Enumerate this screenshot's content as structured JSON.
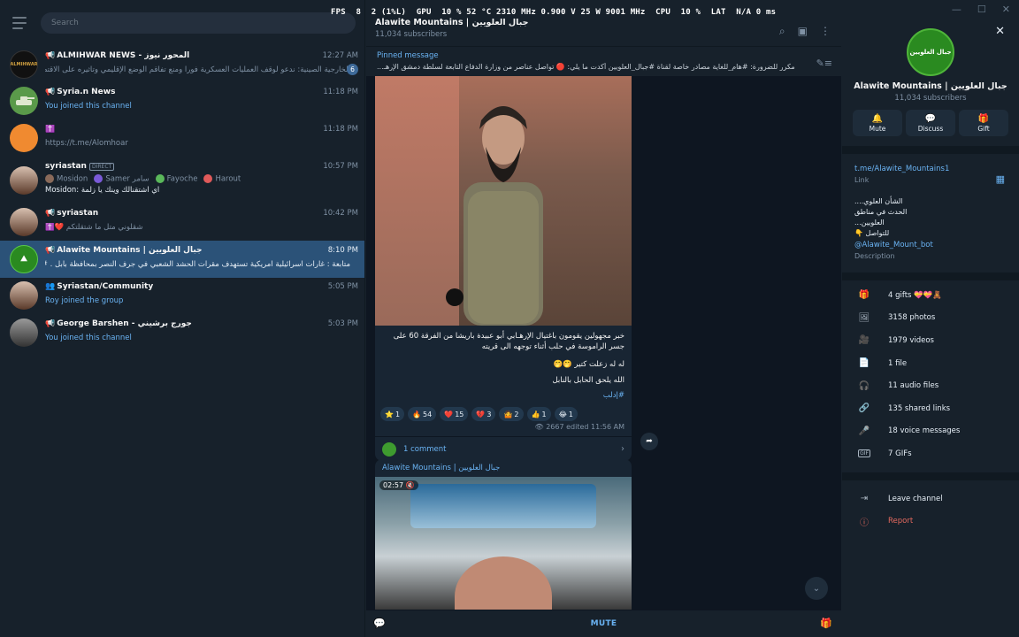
{
  "perf": {
    "fps_label": "FPS",
    "fps_value": "8",
    "fps_extra": "2 (1%L)",
    "gpu_label": "GPU",
    "gpu_value": "10 % 52 °C 2310 MHz 0.900 V 25 W 9001 MHz",
    "cpu_label": "CPU",
    "cpu_value": "10 %",
    "lat_label": "LAT",
    "lat_value": "N/A 0 ms"
  },
  "search": {
    "placeholder": "Search"
  },
  "chats": [
    {
      "title": "ALMIHWAR NEWS - المحور نيوز",
      "message": "الخارجية الصينية: ندعو لوقف العمليات العسكرية فورا ومنع تفاقم الوضع الإقليمي وتأثيره على الاقتصاد...",
      "time": "12:27 AM",
      "unread": "6",
      "avatar_text": "ALMIHWAR",
      "avatar_color": "#111111"
    },
    {
      "title": "Syria.n News",
      "message": "You joined this channel",
      "time": "11:18 PM",
      "avatar_color": "#5a9a4a"
    },
    {
      "title": "✝️",
      "message": "https://t.me/Alomhoar",
      "time": "11:18 PM",
      "avatar_color": "#f08a30"
    },
    {
      "title": "syriastan",
      "direct": "DIRECT",
      "participants": [
        "Mosidon",
        "Samer سامر",
        "Fayoche",
        "Harout"
      ],
      "message": "Mosidon: اي اشتقنالك وينك يا زلمة",
      "time": "10:57 PM",
      "avatar_color": "#8a6a5a"
    },
    {
      "title": "syriastan",
      "message": "شقلوني متل ما شتقلتكم",
      "time": "10:42 PM",
      "avatar_color": "#8a6a5a"
    },
    {
      "title": "Alawite Mountains | جبال العلويين",
      "message": "متابعة : غارات اسرائيلية امريكية تستهدف مقرات الحشد الشعبي في جرف النصر بمحافظة بابل . #رعد",
      "time": "8:10 PM",
      "avatar_color": "#2a8a20"
    },
    {
      "title": "Syriastan/Community",
      "message": "Roy joined the group",
      "time": "5:05 PM",
      "avatar_color": "#8a6a5a"
    },
    {
      "title": "George Barshen - جورج برشيني",
      "message": "You joined this channel",
      "time": "5:03 PM",
      "avatar_color": "#555555"
    }
  ],
  "channel": {
    "title": "Alawite Mountains | جبال العلويين",
    "subscribers": "11,034 subscribers"
  },
  "pinned": {
    "label": "Pinned message",
    "text": "مكرر للضرورة: #هام_للغاية   مصادر خاصة لقناة #جبال_العلويين أكدت ما يلي: 🔴 تواصل عناصر من وزارة الدفاع التابعة لسلطة دمشق الإرهـ..."
  },
  "post": {
    "text1": "خبر مجهولين يقومون باغتيال الإرهـابي أبو عبيدة باريشا من الفرقة 60 على جسر الراموسة في حلب أثناء توجهه الى قريته",
    "text2": "له له زعلت كتير 🤭🤭",
    "text3": "الله يلحق الحابل بالنابل",
    "tag": "#إدلب",
    "reactions": [
      {
        "emoji": "⭐",
        "count": "1"
      },
      {
        "emoji": "🔥",
        "count": "54"
      },
      {
        "emoji": "❤️",
        "count": "15"
      },
      {
        "emoji": "💔",
        "count": "3"
      },
      {
        "emoji": "🤷",
        "count": "2"
      },
      {
        "emoji": "👍",
        "count": "1"
      },
      {
        "emoji": "😂",
        "count": "1"
      }
    ],
    "views": "👁 2667",
    "edited": "edited 11:56 AM",
    "comments": "1 comment"
  },
  "post2": {
    "author": "Alawite Mountains | جبال العلويين",
    "video_time": "02:57 🔇"
  },
  "footer": {
    "mute": "MUTE"
  },
  "profile": {
    "avatar_text": "جبال العلويين",
    "name": "Alawite Mountains | جبال العلويين",
    "subscribers": "11,034 subscribers",
    "actions": [
      {
        "icon": "🔔",
        "label": "Mute"
      },
      {
        "icon": "💬",
        "label": "Discuss"
      },
      {
        "icon": "🎁",
        "label": "Gift"
      }
    ],
    "link": "t.me/Alawite_Mountains1",
    "link_label": "Link",
    "desc_line1": "الشأن العلوي....",
    "desc_line2": "الحدث في مناطق العلويين...",
    "desc_line3": "للتواصل 👇",
    "bot": "@Alawite_Mount_bot",
    "desc_label": "Description",
    "media": [
      {
        "icon": "🎁",
        "label": "4 gifts 💝💝🧸"
      },
      {
        "icon": "🖼",
        "label": "3158 photos"
      },
      {
        "icon": "🎥",
        "label": "1979 videos"
      },
      {
        "icon": "📄",
        "label": "1 file"
      },
      {
        "icon": "🎧",
        "label": "11 audio files"
      },
      {
        "icon": "🔗",
        "label": "135 shared links"
      },
      {
        "icon": "🎤",
        "label": "18 voice messages"
      },
      {
        "icon": "GIF",
        "label": "7 GIFs"
      }
    ],
    "leave": "Leave channel",
    "report": "Report"
  }
}
